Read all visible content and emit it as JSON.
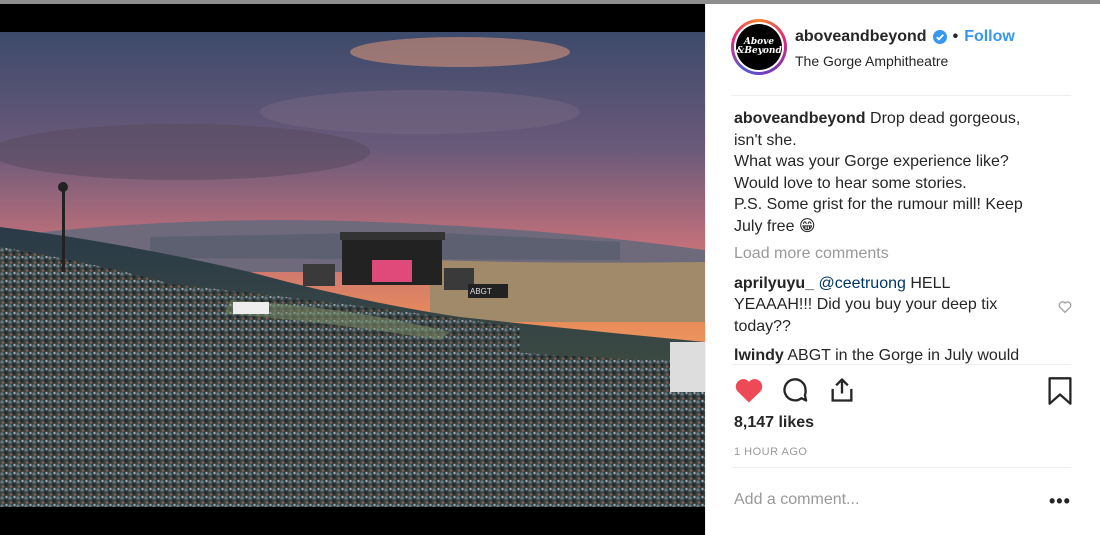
{
  "post": {
    "username": "aboveandbeyond",
    "follow_label": "Follow",
    "location": "The Gorge Amphitheatre",
    "avatar_text": "Above & Beyond",
    "caption": {
      "username": "aboveandbeyond",
      "lines": [
        "Drop dead gorgeous,",
        "isn't she.",
        "What was your Gorge experience like?",
        "Would love to hear some stories.",
        "P.S. Some grist for the rumour mill! Keep",
        "July free 😁"
      ]
    },
    "load_more_label": "Load more comments",
    "comments": [
      {
        "username": "aprilyuyu_",
        "mention": "@ceetruong",
        "text_line1": " HELL",
        "text_line2": "YEAAAH!!! Did you buy your deep tix",
        "text_line3": "today??"
      },
      {
        "username": "lwindy",
        "text": " ABGT in the Gorge in July would"
      }
    ],
    "likes": "8,147 likes",
    "time": "1 HOUR AGO",
    "add_comment_placeholder": "Add a comment...",
    "more_label": "•••",
    "media_stage_banner": "ABGT"
  },
  "colors": {
    "like_red": "#ed4956",
    "follow_blue": "#3897f0",
    "verified_blue": "#3897f0"
  },
  "icons": [
    "heart-filled-icon",
    "comment-icon",
    "share-icon",
    "bookmark-icon",
    "heart-outline-icon",
    "verified-badge-icon"
  ]
}
